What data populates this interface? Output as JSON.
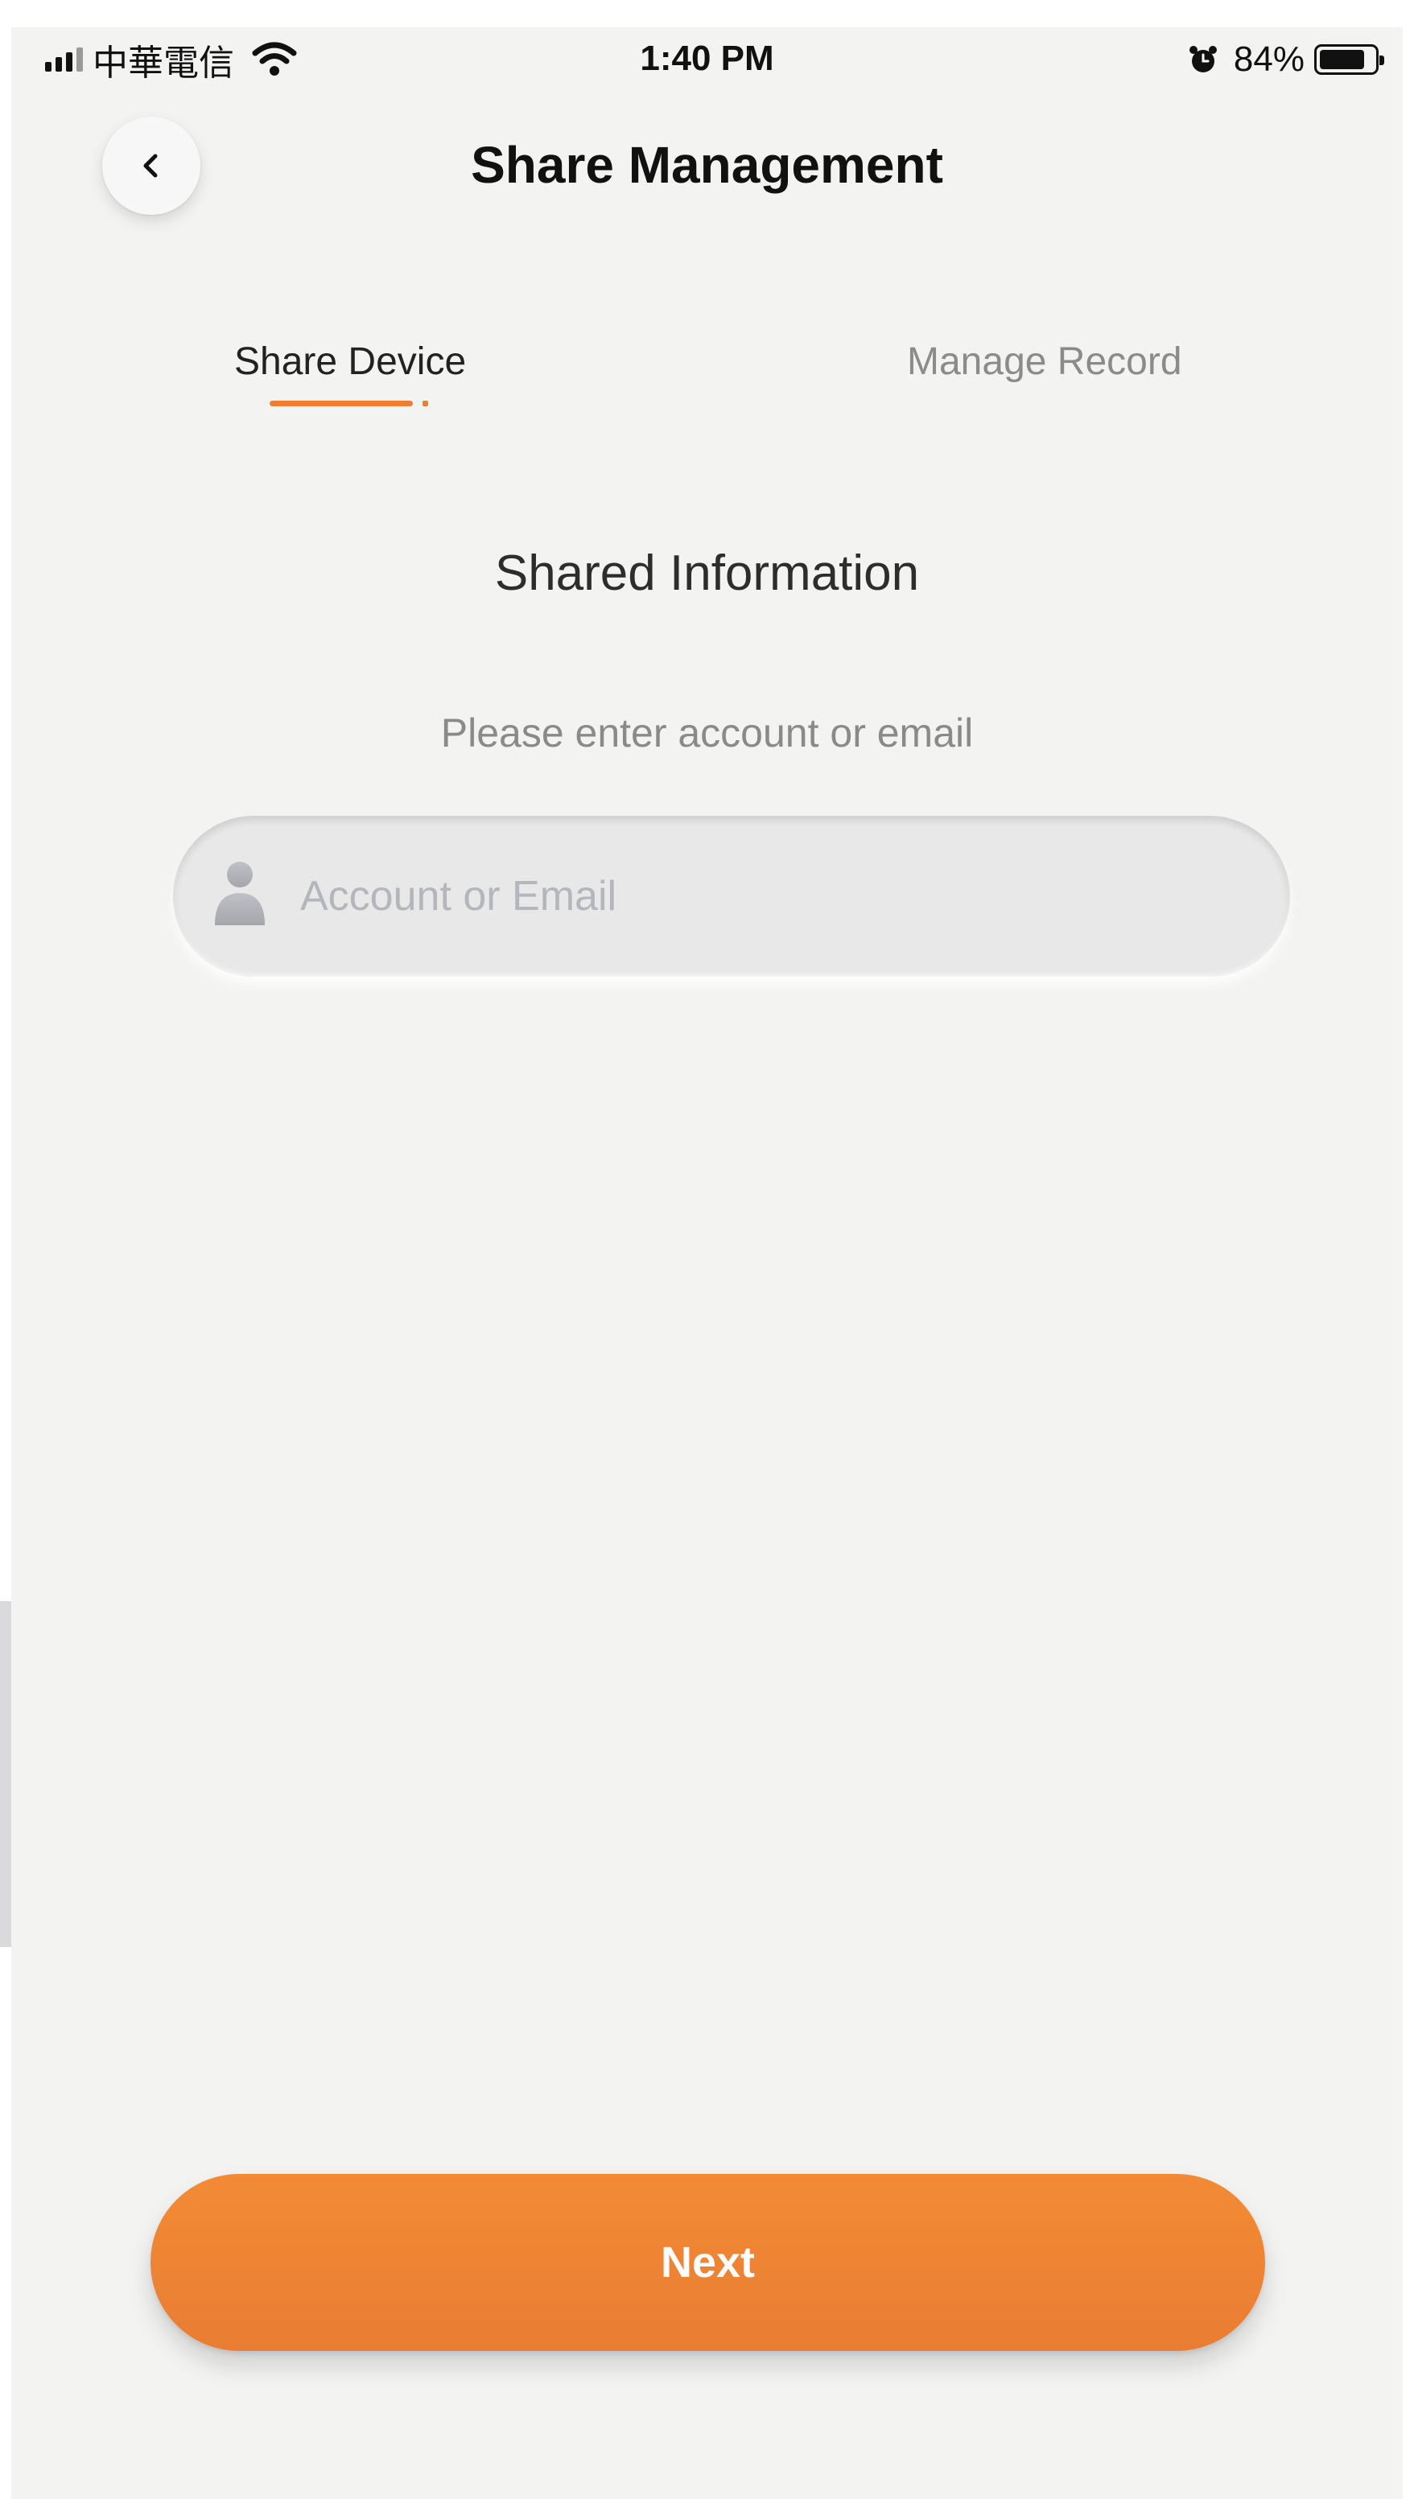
{
  "status_bar": {
    "carrier": "中華電信",
    "time": "1:40 PM",
    "battery_percent": "84%",
    "battery_level": 0.84,
    "icons": [
      "signal-icon",
      "wifi-icon",
      "alarm-icon",
      "battery-icon"
    ]
  },
  "header": {
    "title": "Share Management",
    "back_icon": "chevron-left-icon"
  },
  "tabs": [
    {
      "label": "Share Device",
      "active": true
    },
    {
      "label": "Manage Record",
      "active": false
    }
  ],
  "form": {
    "section_title": "Shared Information",
    "instruction": "Please enter account or email",
    "account_input": {
      "placeholder": "Account or Email",
      "value": "",
      "icon": "user-icon"
    }
  },
  "actions": {
    "next_label": "Next"
  },
  "colors": {
    "accent": "#ee7e35",
    "background": "#f3f3f2",
    "inactive_text": "#8b8b8b",
    "placeholder": "#b4b6bb"
  }
}
